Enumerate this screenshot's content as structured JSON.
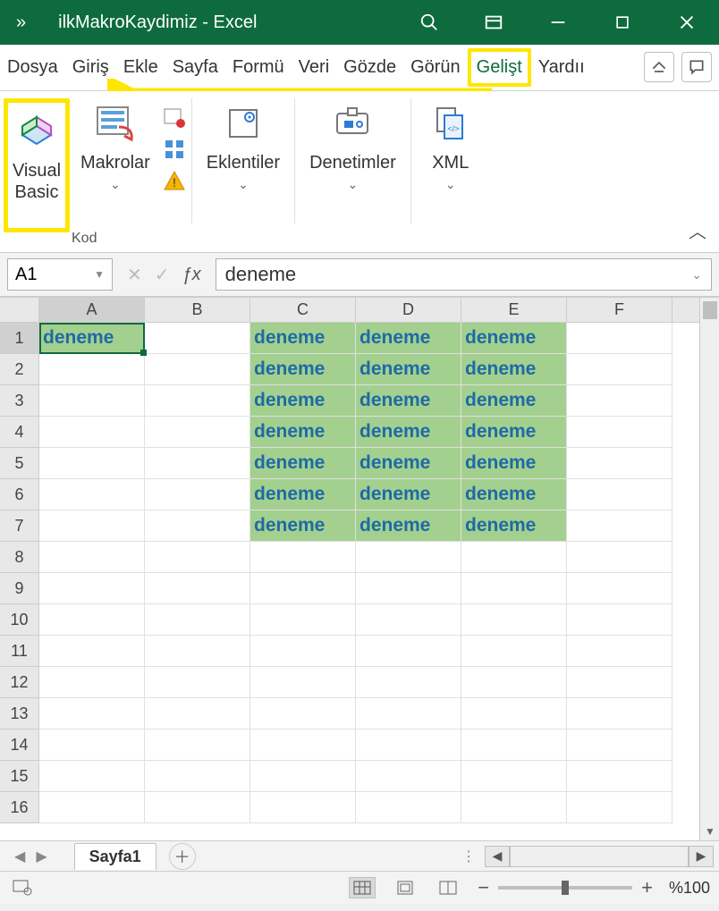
{
  "titlebar": {
    "overflow": "»",
    "title": "ilkMakroKaydimiz  -  Excel"
  },
  "tabs": [
    "Dosya",
    "Giriş",
    "Ekle",
    "Sayfa",
    "Formü",
    "Veri",
    "Gözde",
    "Görün",
    "Gelişt",
    "Yardıı"
  ],
  "active_tab_index": 8,
  "ribbon": {
    "visual_basic": "Visual\nBasic",
    "makrolar": "Makrolar",
    "eklentiler": "Eklentiler",
    "denetimler": "Denetimler",
    "xml": "XML",
    "group_kod": "Kod"
  },
  "namebox": "A1",
  "formula_value": "deneme",
  "columns": [
    "A",
    "B",
    "C",
    "D",
    "E",
    "F"
  ],
  "rows": 16,
  "active_cell": {
    "row": 1,
    "col": "A"
  },
  "cells": {
    "A1": {
      "v": "deneme",
      "green": true,
      "active": true
    },
    "C1": {
      "v": "deneme",
      "green": true
    },
    "D1": {
      "v": "deneme",
      "green": true
    },
    "E1": {
      "v": "deneme",
      "green": true
    },
    "C2": {
      "v": "deneme",
      "green": true
    },
    "D2": {
      "v": "deneme",
      "green": true
    },
    "E2": {
      "v": "deneme",
      "green": true
    },
    "C3": {
      "v": "deneme",
      "green": true
    },
    "D3": {
      "v": "deneme",
      "green": true
    },
    "E3": {
      "v": "deneme",
      "green": true
    },
    "C4": {
      "v": "deneme",
      "green": true
    },
    "D4": {
      "v": "deneme",
      "green": true
    },
    "E4": {
      "v": "deneme",
      "green": true
    },
    "C5": {
      "v": "deneme",
      "green": true
    },
    "D5": {
      "v": "deneme",
      "green": true
    },
    "E5": {
      "v": "deneme",
      "green": true
    },
    "C6": {
      "v": "deneme",
      "green": true
    },
    "D6": {
      "v": "deneme",
      "green": true
    },
    "E6": {
      "v": "deneme",
      "green": true
    },
    "C7": {
      "v": "deneme",
      "green": true
    },
    "D7": {
      "v": "deneme",
      "green": true
    },
    "E7": {
      "v": "deneme",
      "green": true
    }
  },
  "sheet": {
    "name": "Sayfa1"
  },
  "zoom": "%100"
}
